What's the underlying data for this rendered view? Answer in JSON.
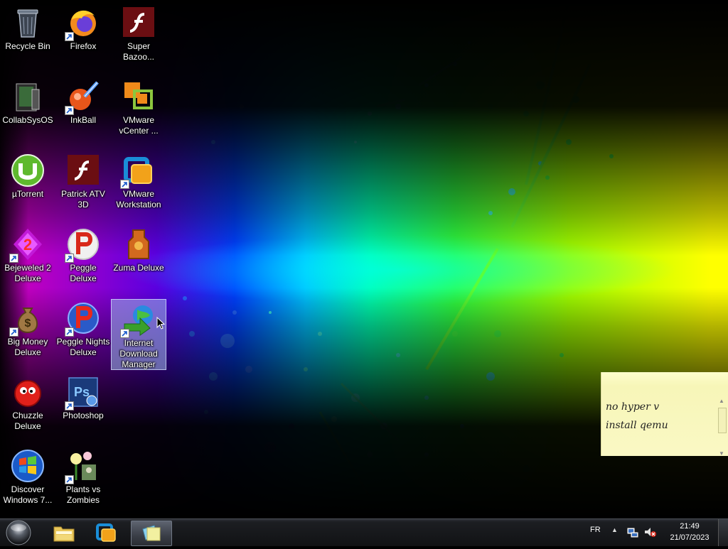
{
  "desktop": {
    "icons": [
      {
        "label": "Recycle Bin",
        "icon": "recycle-bin-icon"
      },
      {
        "label": "Firefox",
        "icon": "firefox-icon"
      },
      {
        "label": "Super\nBazoo...",
        "icon": "flash-icon"
      },
      {
        "label": "CollabSysOS",
        "icon": "collabsysos-icon"
      },
      {
        "label": "InkBall",
        "icon": "inkball-icon"
      },
      {
        "label": "VMware\nvCenter ...",
        "icon": "vmware-vcenter-icon"
      },
      {
        "label": "µTorrent",
        "icon": "utorrent-icon"
      },
      {
        "label": "Patrick ATV\n3D",
        "icon": "flash-icon"
      },
      {
        "label": "VMware\nWorkstation",
        "icon": "vmware-workstation-icon"
      },
      {
        "label": "Bejeweled 2\nDeluxe",
        "icon": "bejeweled-icon"
      },
      {
        "label": "Peggle Deluxe",
        "icon": "peggle-icon"
      },
      {
        "label": "Zuma Deluxe",
        "icon": "zuma-icon"
      },
      {
        "label": "Big Money\nDeluxe",
        "icon": "money-bag-icon"
      },
      {
        "label": "Peggle Nights\nDeluxe",
        "icon": "peggle-nights-icon"
      },
      {
        "label": "Internet\nDownload\nManager",
        "icon": "idm-icon"
      },
      {
        "label": "Chuzzle\nDeluxe",
        "icon": "chuzzle-icon"
      },
      {
        "label": "Photoshop",
        "icon": "photoshop-icon"
      },
      {
        "label": "Discover\nWindows 7...",
        "icon": "windows-logo-icon"
      },
      {
        "label": "Plants vs\nZombies",
        "icon": "plants-vs-zombies-icon"
      }
    ],
    "selected_icon": "Internet Download Manager"
  },
  "sticky_note": {
    "lines": [
      "no hyper v",
      "install qemu"
    ]
  },
  "taskbar": {
    "pinned": [
      {
        "name": "Windows Explorer",
        "icon": "explorer-folder-icon"
      },
      {
        "name": "VMware Workstation",
        "icon": "vmware-workstation-icon"
      },
      {
        "name": "Sticky Notes",
        "icon": "sticky-notes-icon",
        "active": true
      }
    ],
    "tray": {
      "language": "FR",
      "show_hidden": "▲",
      "network_icon": "network-icon",
      "volume_icon": "volume-muted-icon"
    },
    "clock": {
      "time": "21:49",
      "date": "21/07/2023"
    }
  },
  "colors": {
    "taskbar": "#16171a",
    "sticky_note": "#f9f8c0",
    "selection": "#a0beeb"
  }
}
